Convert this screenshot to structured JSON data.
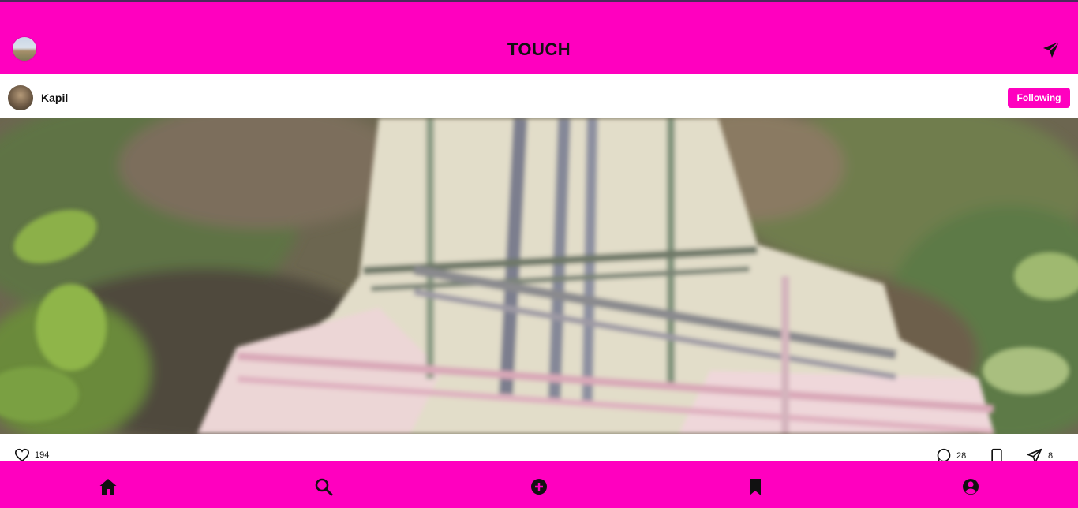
{
  "app": {
    "title": "TOUCH",
    "brand_color": "#ff00bf"
  },
  "header": {
    "left_icon": "profile-avatar",
    "right_icon": "send-icon"
  },
  "post": {
    "author": "Kapil",
    "follow_label": "Following",
    "stats": {
      "likes": "194",
      "comments": "28",
      "shares": "8"
    }
  },
  "bottom_nav": {
    "items": [
      {
        "icon": "home-icon"
      },
      {
        "icon": "search-icon"
      },
      {
        "icon": "add-circle-icon"
      },
      {
        "icon": "bookmark-icon"
      },
      {
        "icon": "account-icon"
      }
    ]
  }
}
